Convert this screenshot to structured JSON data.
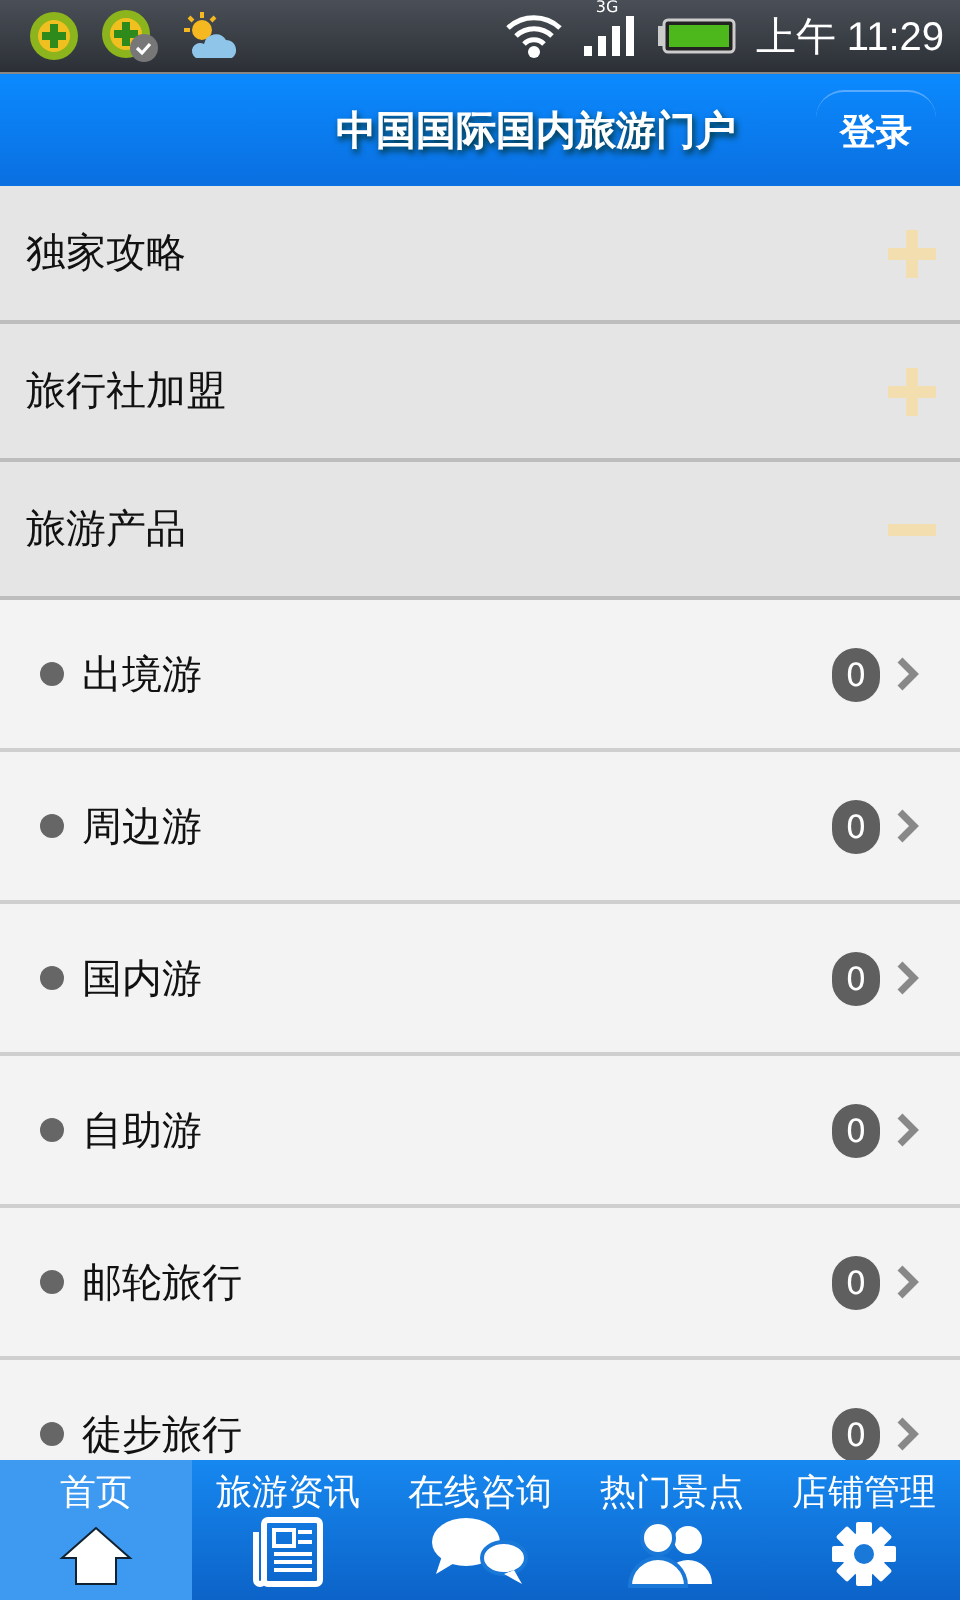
{
  "status_bar": {
    "network": "3G",
    "time": "上午 11:29"
  },
  "header": {
    "title": "中国国际国内旅游门户",
    "login": "登录"
  },
  "sections": [
    {
      "title": "独家攻略",
      "expanded": false
    },
    {
      "title": "旅行社加盟",
      "expanded": false
    },
    {
      "title": "旅游产品",
      "expanded": true,
      "children": [
        {
          "label": "出境游",
          "count": "0"
        },
        {
          "label": "周边游",
          "count": "0"
        },
        {
          "label": "国内游",
          "count": "0"
        },
        {
          "label": "自助游",
          "count": "0"
        },
        {
          "label": "邮轮旅行",
          "count": "0"
        },
        {
          "label": "徒步旅行",
          "count": "0"
        }
      ]
    }
  ],
  "nav": [
    {
      "label": "首页",
      "kind": "home",
      "selected": true
    },
    {
      "label": "旅游资讯",
      "kind": "news",
      "selected": false
    },
    {
      "label": "在线咨询",
      "kind": "chat",
      "selected": false
    },
    {
      "label": "热门景点",
      "kind": "people",
      "selected": false
    },
    {
      "label": "店铺管理",
      "kind": "gear",
      "selected": false
    }
  ]
}
